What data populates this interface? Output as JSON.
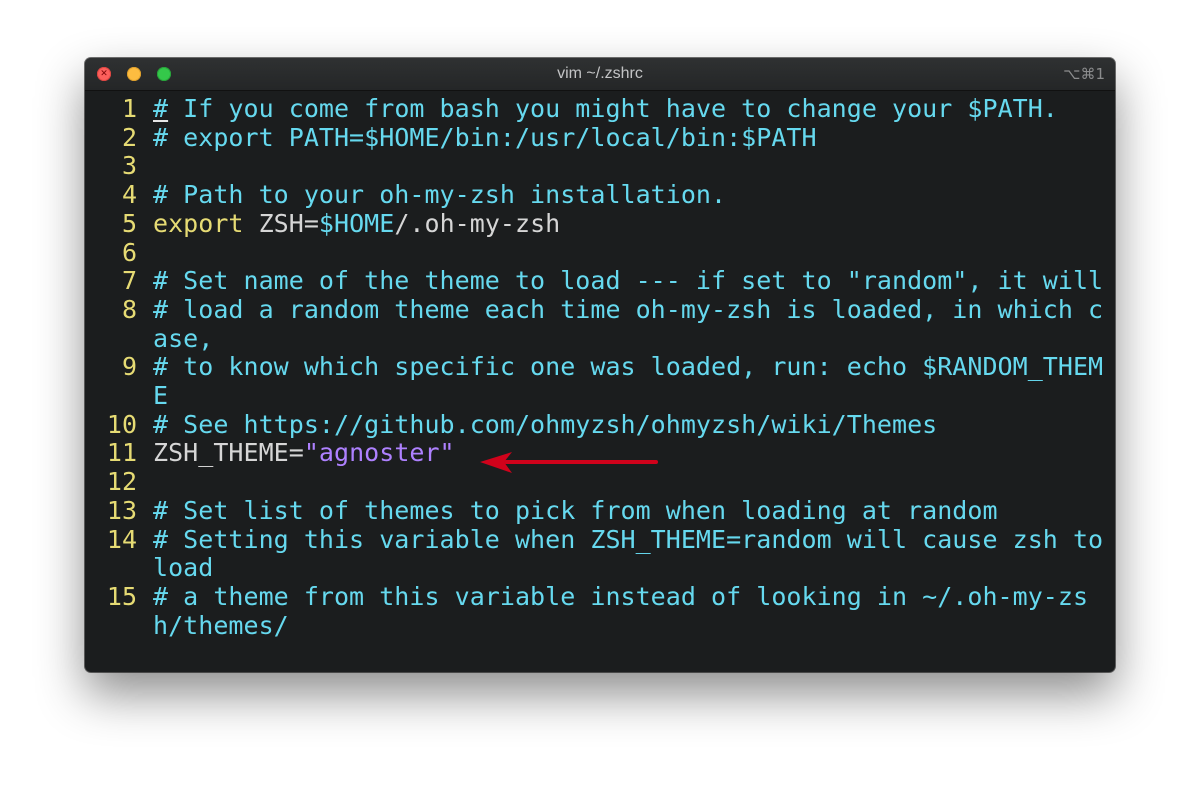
{
  "window": {
    "title": "vim ~/.zshrc",
    "shortcut": "⌥⌘1"
  },
  "editor": {
    "lines": [
      {
        "num": "1",
        "cursor": "#",
        "text": " If you come from bash you might have to change your $PATH."
      },
      {
        "num": "2",
        "text": "# export PATH=$HOME/bin:/usr/local/bin:$PATH"
      },
      {
        "num": "3",
        "text": ""
      },
      {
        "num": "4",
        "text": "# Path to your oh-my-zsh installation."
      },
      {
        "num": "5",
        "keyword": "export",
        "plain": " ZSH=",
        "variable": "$HOME",
        "rest": "/.oh-my-zsh"
      },
      {
        "num": "6",
        "text": ""
      },
      {
        "num": "7",
        "text": "# Set name of the theme to load --- if set to \"random\", it will"
      },
      {
        "num": "8",
        "text": "# load a random theme each time oh-my-zsh is loaded, in which case,"
      },
      {
        "num": "9",
        "text": "# to know which specific one was loaded, run: echo $RANDOM_THEME"
      },
      {
        "num": "10",
        "text": "# See https://github.com/ohmyzsh/ohmyzsh/wiki/Themes"
      },
      {
        "num": "11",
        "plain": "ZSH_THEME=",
        "string": "\"agnoster\""
      },
      {
        "num": "12",
        "text": ""
      },
      {
        "num": "13",
        "text": "# Set list of themes to pick from when loading at random"
      },
      {
        "num": "14",
        "text": "# Setting this variable when ZSH_THEME=random will cause zsh to load"
      },
      {
        "num": "15",
        "text": "# a theme from this variable instead of looking in ~/.oh-my-zsh/themes/"
      }
    ]
  },
  "colors": {
    "background": "#1b1d1e",
    "line_numbers": "#e6db74",
    "comments": "#66d9ef",
    "string": "#ae81ff",
    "annotation_arrow": "#d0021b"
  }
}
